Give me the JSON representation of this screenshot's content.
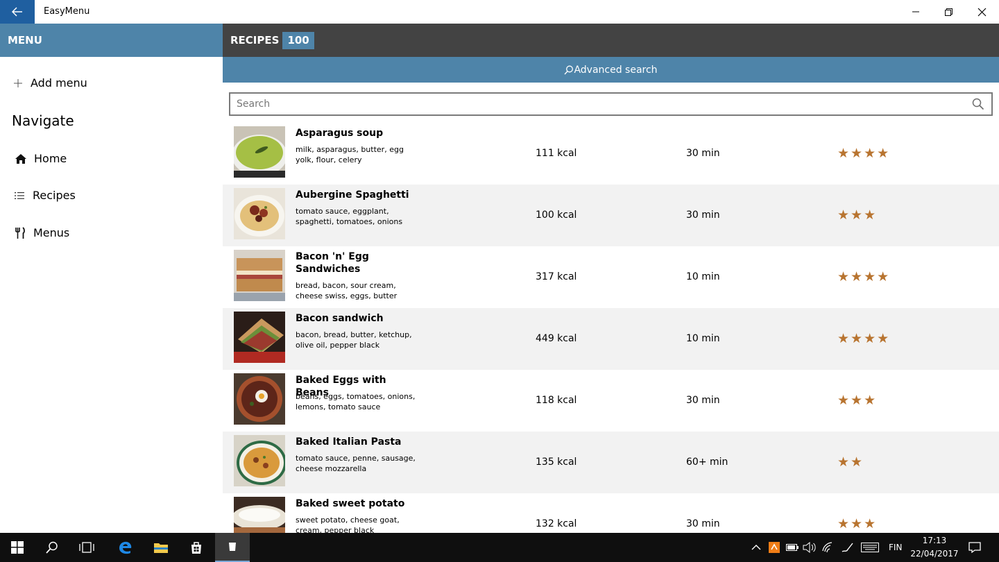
{
  "window": {
    "app_title": "EasyMenu"
  },
  "sidebar": {
    "header": "MENU",
    "add_menu_label": "Add menu",
    "navigate_title": "Navigate",
    "items": [
      {
        "label": "Home",
        "icon": "home-icon"
      },
      {
        "label": "Recipes",
        "icon": "list-icon"
      },
      {
        "label": "Menus",
        "icon": "cutlery-icon"
      }
    ]
  },
  "main": {
    "header_title": "RECIPES",
    "recipe_count": "100",
    "advanced_search_label": "Advanced search",
    "search_placeholder": "Search",
    "recipes": [
      {
        "name": "Asparagus soup",
        "ingredients": "milk, asparagus, butter, egg yolk, flour, celery",
        "kcal": "111 kcal",
        "time": "30 min",
        "rating": 4
      },
      {
        "name": "Aubergine Spaghetti",
        "ingredients": "tomato sauce, eggplant, spaghetti, tomatoes, onions",
        "kcal": "100 kcal",
        "time": "30 min",
        "rating": 3
      },
      {
        "name": "Bacon 'n' Egg Sandwiches",
        "ingredients": "bread, bacon, sour cream, cheese swiss, eggs, butter",
        "kcal": "317 kcal",
        "time": "10 min",
        "rating": 4
      },
      {
        "name": "Bacon sandwich",
        "ingredients": "bacon, bread, butter, ketchup, olive oil, pepper black",
        "kcal": "449 kcal",
        "time": "10 min",
        "rating": 4
      },
      {
        "name": "Baked Eggs with Beans",
        "ingredients": "beans, eggs, tomatoes, onions, lemons, tomato sauce",
        "kcal": "118 kcal",
        "time": "30 min",
        "rating": 3
      },
      {
        "name": "Baked Italian Pasta",
        "ingredients": "tomato sauce, penne, sausage, cheese mozzarella",
        "kcal": "135 kcal",
        "time": "60+ min",
        "rating": 2
      },
      {
        "name": "Baked sweet potato",
        "ingredients": "sweet potato, cheese goat, cream, pepper black",
        "kcal": "132 kcal",
        "time": "30 min",
        "rating": 3
      }
    ]
  },
  "taskbar": {
    "language": "FIN",
    "time": "17:13",
    "date": "22/04/2017"
  },
  "colors": {
    "accent": "#4e84a9",
    "header_dark": "#434343",
    "star": "#b87430",
    "back_button": "#1f5fa0"
  }
}
